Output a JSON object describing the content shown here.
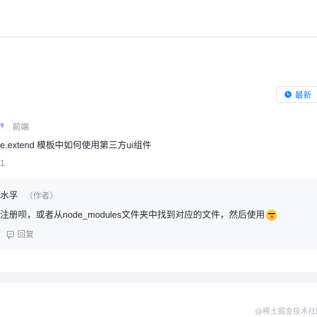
{
  "sort": {
    "label": "最新",
    "icon": "clock-icon"
  },
  "question": {
    "category": "前端",
    "category_icon": "category-tag-icon",
    "title": "e.extend 模板中如何使用第三方ui组件",
    "count": "1"
  },
  "reply": {
    "author": "水孚",
    "author_tag": "（作者）",
    "text": "注册呗，或者从node_modules文件夹中找到对应的文件，然后使用",
    "emoji": "grinning-tongue-face-icon",
    "action_label": "回复",
    "action_icon": "comment-icon"
  },
  "watermark": {
    "text": "@稀土掘金技术社区"
  },
  "colors": {
    "accent": "#1e80ff",
    "muted_text": "#8a919f",
    "reply_background": "#f7f8fa",
    "category": "#b39bf3"
  }
}
